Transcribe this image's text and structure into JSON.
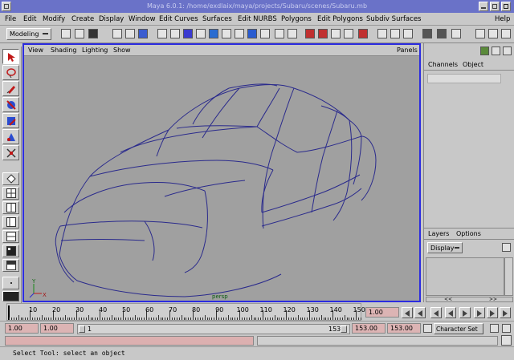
{
  "window": {
    "title": "Maya 6.0.1: /home/exdlaix/maya/projects/Subaru/scenes/Subaru.mb"
  },
  "menubar": {
    "items": [
      "File",
      "Edit",
      "Modify",
      "Create",
      "Display",
      "Window",
      "Edit Curves",
      "Surfaces",
      "Edit NURBS",
      "Polygons",
      "Edit Polygons",
      "Subdiv Surfaces"
    ],
    "help": "Help"
  },
  "shelf": {
    "mode": "Modeling"
  },
  "viewport": {
    "menu": [
      "View",
      "Shading",
      "Lighting",
      "Show"
    ],
    "panels": "Panels",
    "camera": "persp",
    "axis": {
      "y": "Y",
      "x": "X"
    }
  },
  "channel_box": {
    "tabs": [
      "Channels",
      "Object"
    ]
  },
  "layers": {
    "tabs": [
      "Layers",
      "Options"
    ],
    "display": "Display"
  },
  "timeline": {
    "ticks": [
      "10",
      "20",
      "30",
      "40",
      "50",
      "60",
      "70",
      "80",
      "90",
      "100",
      "110",
      "120",
      "130",
      "140",
      "150"
    ],
    "current_time": "1.00"
  },
  "range": {
    "start_time": "1.00",
    "playback_start": "1.00",
    "slider_start": "1",
    "slider_end": "153",
    "playback_end": "153.00",
    "end_time": "153.00",
    "character_set": "Character Set"
  },
  "help_line": "Select Tool: select an object",
  "colors": {
    "viewport_bg": "#a0a0a0",
    "wire": "#2a2a8c",
    "title_bar": "#6a72c8",
    "active_border": "#2c2ce0"
  }
}
